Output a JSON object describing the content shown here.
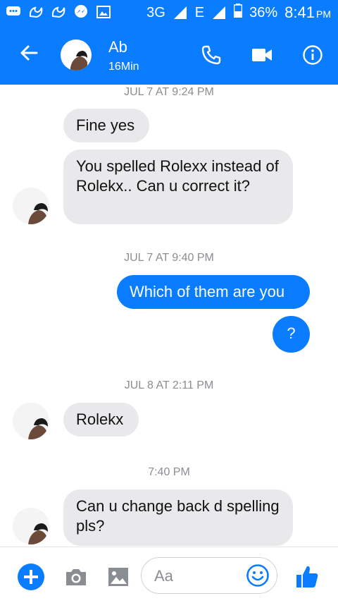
{
  "status_bar": {
    "network_label": "3G",
    "network_label_2": "E",
    "battery": "36%",
    "time": "8:41",
    "ampm": "PM",
    "icons": [
      "chat-bubble-icon",
      "uc-browser-icon",
      "uc-browser-icon",
      "messenger-icon",
      "gallery-icon",
      "signal-icon",
      "battery-icon"
    ]
  },
  "header": {
    "contact_name": "Ab",
    "active_status": "16Min",
    "icons": [
      "back-arrow-icon",
      "phone-icon",
      "video-icon",
      "info-icon"
    ]
  },
  "thread": {
    "timestamps": [
      "JUL 7 AT 9:24 PM",
      "JUL 7 AT 9:40 PM",
      "JUL 8 AT 2:11 PM",
      "7:40 PM"
    ],
    "messages": [
      {
        "side": "in",
        "text": "Fine yes"
      },
      {
        "side": "in",
        "text": "You spelled Rolexx instead of Rolekx.. Can u correct it?"
      },
      {
        "side": "out",
        "text": "Which of them are you"
      },
      {
        "side": "out",
        "text": "?"
      },
      {
        "side": "in",
        "text": "Rolekx"
      },
      {
        "side": "in",
        "text": "Can u change back d spelling pls?"
      }
    ]
  },
  "composer": {
    "placeholder": "Aa",
    "icons": [
      "plus-icon",
      "camera-icon",
      "image-icon",
      "emoji-icon",
      "thumbs-up-icon"
    ]
  },
  "colors": {
    "accent": "#0a7cff",
    "incoming_bubble": "#e9e9eb",
    "timestamp": "#8a8d91"
  }
}
